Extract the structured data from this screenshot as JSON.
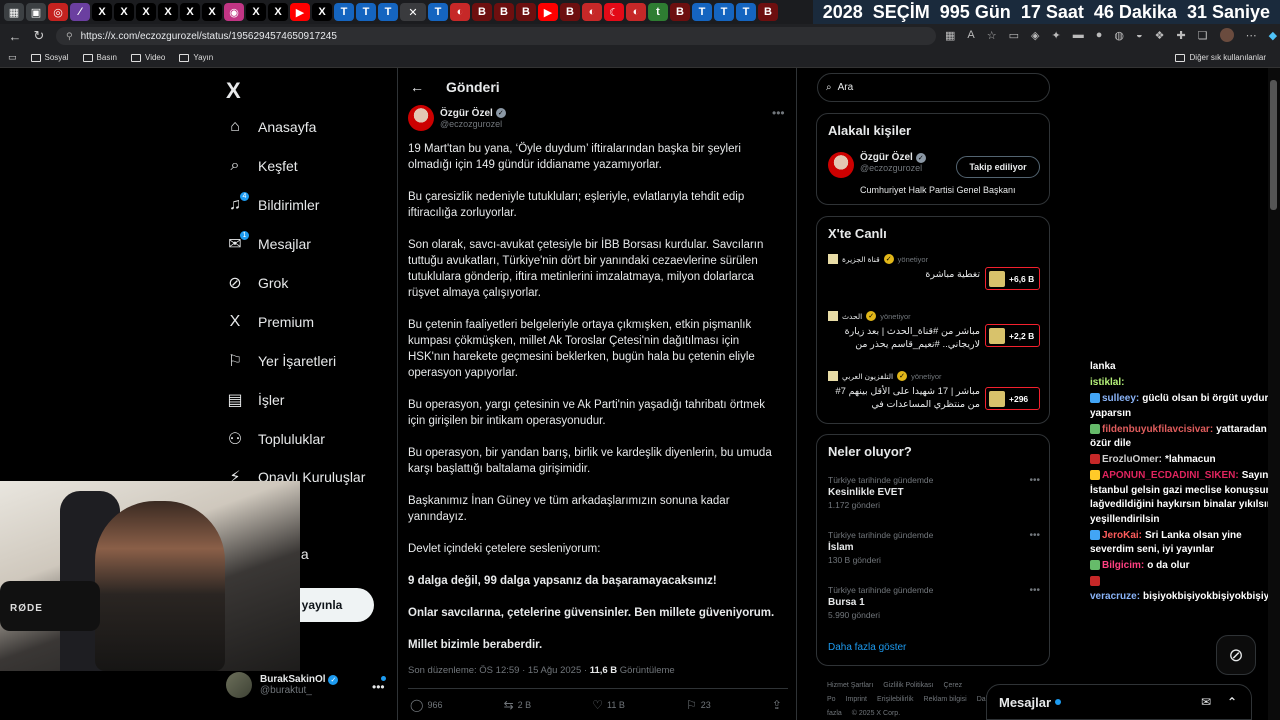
{
  "browser": {
    "tabs": [
      {
        "g": "▦",
        "bg": "#3c4043"
      },
      {
        "g": "▣",
        "bg": "#3c4043"
      },
      {
        "g": "◎",
        "bg": "#c5221f"
      },
      {
        "g": "⁄",
        "bg": "#6b3fa0"
      },
      {
        "g": "X",
        "bg": "#000000"
      },
      {
        "g": "X",
        "bg": "#000000"
      },
      {
        "g": "X",
        "bg": "#000000"
      },
      {
        "g": "X",
        "bg": "#000000"
      },
      {
        "g": "X",
        "bg": "#000000"
      },
      {
        "g": "X",
        "bg": "#000000"
      },
      {
        "g": "◉",
        "bg": "#c13584"
      },
      {
        "g": "X",
        "bg": "#000000"
      },
      {
        "g": "X",
        "bg": "#000000"
      },
      {
        "g": "▶",
        "bg": "#ff0000"
      },
      {
        "g": "X",
        "bg": "#000000"
      },
      {
        "g": "T",
        "bg": "#1565c0"
      },
      {
        "g": "T",
        "bg": "#1565c0"
      },
      {
        "g": "T",
        "bg": "#1565c0"
      },
      {
        "g": "✕",
        "bg": "#3a3b3e",
        "active": true
      },
      {
        "g": "T",
        "bg": "#1565c0"
      },
      {
        "g": "◐",
        "bg": "#c62828"
      },
      {
        "g": "B",
        "bg": "#6d0f0f"
      },
      {
        "g": "B",
        "bg": "#6d0f0f"
      },
      {
        "g": "B",
        "bg": "#6d0f0f"
      },
      {
        "g": "▶",
        "bg": "#ff0000"
      },
      {
        "g": "B",
        "bg": "#6d0f0f"
      },
      {
        "g": "◐",
        "bg": "#c62828"
      },
      {
        "g": "☾",
        "bg": "#e30a17"
      },
      {
        "g": "◐",
        "bg": "#c62828"
      },
      {
        "g": "t",
        "bg": "#2e7d32"
      },
      {
        "g": "B",
        "bg": "#6d0f0f"
      },
      {
        "g": "T",
        "bg": "#1565c0"
      },
      {
        "g": "T",
        "bg": "#1565c0"
      },
      {
        "g": "T",
        "bg": "#1565c0"
      },
      {
        "g": "B",
        "bg": "#6d0f0f"
      }
    ],
    "url": "https://x.com/eczozgurozel/status/1956294574650917245",
    "bookmarks": [
      "Sosyal",
      "Basın",
      "Video",
      "Yayın"
    ],
    "other_bookmarks": "Diğer sık kullanılanlar"
  },
  "countdown": [
    "2028",
    "SEÇİM",
    "995 Gün",
    "17 Saat",
    "46 Dakika",
    "31 Saniye"
  ],
  "nav": {
    "logo": "X",
    "items": [
      {
        "label": "Anasayfa",
        "icon": "⌂",
        "name": "home"
      },
      {
        "label": "Keşfet",
        "icon": "⌕",
        "name": "explore"
      },
      {
        "label": "Bildirimler",
        "icon": "♫",
        "name": "notifications",
        "badge": "4"
      },
      {
        "label": "Mesajlar",
        "icon": "✉",
        "name": "messages",
        "badge": "1"
      },
      {
        "label": "Grok",
        "icon": "⊘",
        "name": "grok"
      },
      {
        "label": "Premium",
        "icon": "X",
        "name": "premium"
      },
      {
        "label": "Yer İşaretleri",
        "icon": "⚐",
        "name": "bookmarks"
      },
      {
        "label": "İşler",
        "icon": "▤",
        "name": "jobs"
      },
      {
        "label": "Topluluklar",
        "icon": "⚇",
        "name": "communities"
      },
      {
        "label": "Onaylı Kuruluşlar",
        "icon": "⚡",
        "name": "verified-orgs"
      }
    ],
    "more_partial": "azla",
    "post_partial": "yayınla",
    "account": {
      "name": "BurakSakinOl",
      "handle": "@buraktut_"
    }
  },
  "webcam": {
    "mic_label": "RØDE"
  },
  "post": {
    "header": "Gönderi",
    "author_name": "Özgür Özel",
    "author_handle": "@eczozgurozel",
    "paragraphs": [
      {
        "text": "19 Mart'tan bu yana, ‘Öyle duydum’ iftiralarından başka bir şeyleri olmadığı için 149 gündür iddianame yazamıyorlar.",
        "bold": false
      },
      {
        "text": "Bu çaresizlik nedeniyle tutukluları; eşleriyle, evlatlarıyla tehdit edip iftiracılığa zorluyorlar.",
        "bold": false
      },
      {
        "text": "Son olarak, savcı-avukat çetesiyle bir İBB Borsası kurdular. Savcıların tuttuğu avukatları, Türkiye'nin dört bir yanındaki cezaevlerine sürülen tutuklulara gönderip, iftira metinlerini imzalatmaya, milyon dolarlarca rüşvet almaya çalışıyorlar.",
        "bold": false
      },
      {
        "text": "Bu çetenin faaliyetleri belgeleriyle ortaya çıkmışken, etkin pişmanlık kumpası çökmüşken, millet Ak Toroslar Çetesi'nin dağıtılması için HSK'nın harekete geçmesini beklerken, bugün hala bu çetenin eliyle operasyon yapıyorlar.",
        "bold": false
      },
      {
        "text": "Bu operasyon, yargı çetesinin ve Ak Parti'nin yaşadığı tahribatı örtmek için girişilen bir intikam operasyonudur.",
        "bold": false
      },
      {
        "text": "Bu operasyon, bir yandan barış, birlik ve kardeşlik diyenlerin, bu umuda karşı başlattığı baltalama girişimidir.",
        "bold": false
      },
      {
        "text": "Başkanımız İnan Güney ve tüm arkadaşlarımızın sonuna kadar yanındayız.",
        "bold": false
      },
      {
        "text": "Devlet içindeki çetelere sesleniyorum:",
        "bold": false
      },
      {
        "text": "9 dalga değil, 99 dalga yapsanız da başaramayacaksınız!",
        "bold": true
      },
      {
        "text": "Onlar savcılarına, çetelerine güvensinler. Ben millete güveniyorum.",
        "bold": true
      },
      {
        "text": "Millet bizimle beraberdir.",
        "bold": true
      }
    ],
    "meta_prefix": "Son düzenleme: ÖS 12:59 · 15 Ağu 2025 · ",
    "views_count": "11,6 B",
    "views_label": " Görüntüleme",
    "actions": {
      "replies": "966",
      "reposts": "2 B",
      "likes": "11 B",
      "bookmarks": "23"
    }
  },
  "sidebar": {
    "search_placeholder": "Ara",
    "related": {
      "title": "Alakalı kişiler",
      "name": "Özgür Özel",
      "handle": "@eczozgurozel",
      "button": "Takip ediliyor",
      "bio": "Cumhuriyet Halk Partisi Genel Başkanı"
    },
    "live": {
      "title": "X'te Canlı",
      "items": [
        {
          "source": "قناة الجزيرة",
          "hosting": "yönetiyor",
          "text": "تغطية مباشرة",
          "count": "+6,6 B"
        },
        {
          "source": "الحدث",
          "hosting": "yönetiyor",
          "text": "مباشر من #قناة_الحدث | بعد زيارة لاريجاني.. #نعيم_قاسم يحذر من",
          "count": "+2,2 B"
        },
        {
          "source": "التلفزيون العربي",
          "hosting": "yönetiyor",
          "text": "مباشر | 17 شهيدا على الأقل بينهم 7# من منتظري المساعدات في",
          "count": "+296"
        }
      ]
    },
    "trends": {
      "title": "Neler oluyor?",
      "items": [
        {
          "context": "Türkiye tarihinde gündemde",
          "name": "Kesinlikle EVET",
          "count": "1.172 gönderi"
        },
        {
          "context": "Türkiye tarihinde gündemde",
          "name": "İslam",
          "count": "130 B gönderi"
        },
        {
          "context": "Türkiye tarihinde gündemde",
          "name": "Bursa 1",
          "count": "5.990 gönderi"
        }
      ],
      "show_more": "Daha fazla göster"
    },
    "footer": [
      "Hizmet Şartları",
      "Gizlilik Politikası",
      "Çerez Po",
      "Imprint",
      "Erişilebilirlik",
      "Reklam bilgisi",
      "Daha fazla",
      "© 2025 X Corp."
    ]
  },
  "chat": [
    {
      "user": "",
      "text": "lanka",
      "color": "#ffffff"
    },
    {
      "user": "istiklal:",
      "text": "",
      "color": "#b6f27a"
    },
    {
      "user": "sulleey:",
      "text": "güclü olsan bi örgüt uydurur yaparsın",
      "color": "#8ab4f8"
    },
    {
      "user": "fildenbuyukfilavcisivar:",
      "text": "yattaradan özür dile",
      "color": "#e05d5d"
    },
    {
      "user": "ErozluOmer:",
      "text": "*lahmacun",
      "color": "#cfcfcf"
    },
    {
      "user": "APONUN_ECDADINI_SIKEN:",
      "text": "Sayın İstanbul gelsin gazi meclise konuşsun lağvedildiğini haykırsın binalar yıkılsın yeşillendirilsin",
      "color": "#e0245e"
    },
    {
      "user": "JeroKai:",
      "text": "Sri Lanka olsan yine severdim seni, iyi yayınlar",
      "color": "#ff5c5c"
    },
    {
      "user": "Bilgicim:",
      "text": "o da olur",
      "color": "#ff4081"
    },
    {
      "user": "veracruze:",
      "text": "bişiyokbişiyokbişiyokbişiyok",
      "color": "#8ab4f8"
    }
  ],
  "messages_bar": "Mesajlar",
  "colors": {
    "accent": "#1d9bf0",
    "live_red": "#f4212e"
  }
}
